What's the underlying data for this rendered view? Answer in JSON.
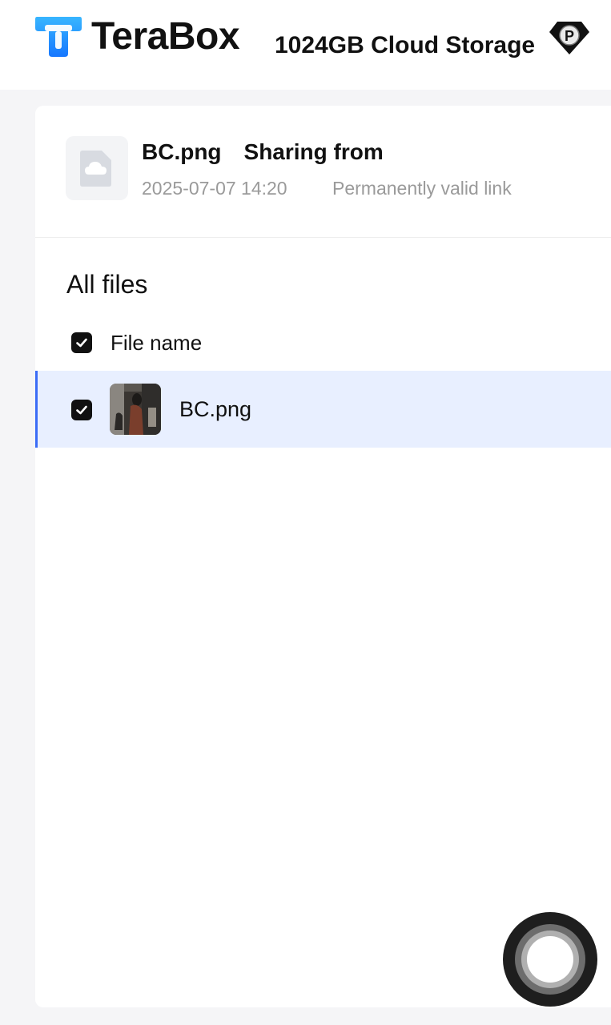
{
  "header": {
    "brand": "TeraBox",
    "storage_label": "1024GB Cloud Storage",
    "premium_badge": "P",
    "colors": {
      "brand_blue": "#1a8cff"
    }
  },
  "share": {
    "file_name": "BC.png",
    "sharing_label": "Sharing from",
    "date": "2025-07-07 14:20",
    "validity": "Permanently valid link"
  },
  "files": {
    "section_title": "All files",
    "column_header": "File name",
    "items": [
      {
        "name": "BC.png",
        "selected": true
      }
    ]
  },
  "icons": {
    "logo": "terabox-logo-icon",
    "premium": "premium-diamond-icon",
    "file": "cloud-file-icon",
    "check": "checkmark-icon"
  },
  "colors": {
    "selected_row_bg": "#e8efff",
    "selected_row_accent": "#3b6cf6"
  }
}
